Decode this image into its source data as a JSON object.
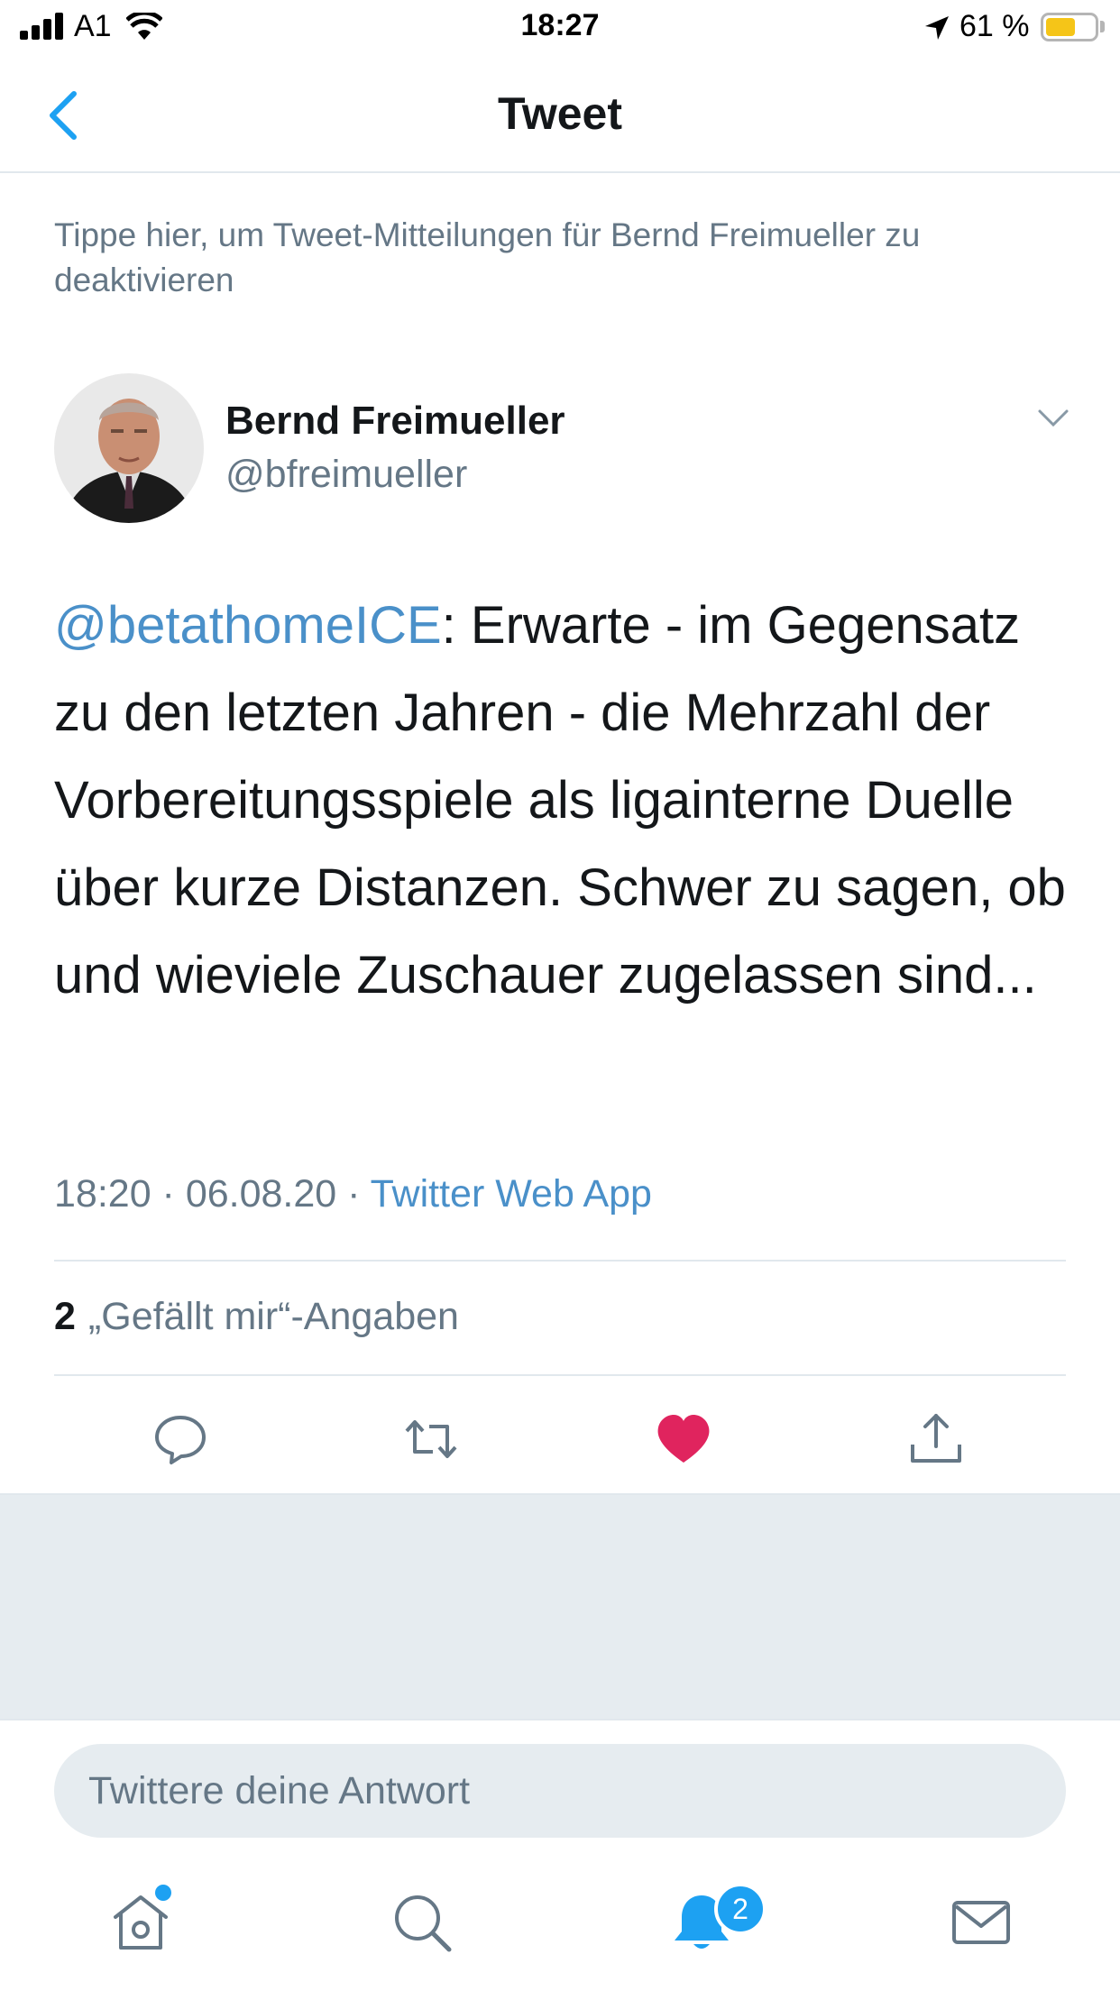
{
  "status_bar": {
    "carrier": "A1",
    "time": "18:27",
    "battery_percent": "61 %",
    "battery_level": 0.61,
    "icons": [
      "signal-icon",
      "wifi-icon",
      "location-arrow-icon",
      "battery-icon"
    ]
  },
  "nav": {
    "title": "Tweet",
    "back_icon": "chevron-left-icon"
  },
  "notice": "Tippe hier, um Tweet-Mitteilungen für Bernd Freimueller zu deaktivieren",
  "author": {
    "name": "Bernd Freimueller",
    "handle": "@bfreimueller"
  },
  "tweet": {
    "mention": "@betathomeICE",
    "text": ":  Erwarte - im Gegensatz zu den letzten Jahren - die Mehrzahl der Vorbereitungsspiele als ligainterne Duelle über kurze Distanzen. Schwer zu sagen, ob und wieviele Zuschauer zugelassen sind...",
    "time": "18:20",
    "date": "06.08.20",
    "separator": " · ",
    "source": "Twitter Web App"
  },
  "likes": {
    "count": "2",
    "label": "„Gefällt mir“-Angaben"
  },
  "actions": [
    "reply-icon",
    "retweet-icon",
    "like-icon",
    "share-icon"
  ],
  "colors": {
    "accent": "#1da1f2",
    "like": "#e0245e",
    "muted": "#657786"
  },
  "reply_box": {
    "placeholder": "Twittere deine Antwort"
  },
  "tab_bar": {
    "items": [
      "home-icon",
      "search-icon",
      "notifications-icon",
      "messages-icon"
    ],
    "notifications_badge": "2"
  }
}
